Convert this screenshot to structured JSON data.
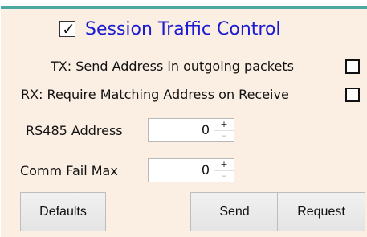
{
  "header": {
    "checked": true,
    "check_glyph": "✓",
    "title": "Session Traffic Control"
  },
  "options": {
    "tx_label": "TX: Send Address in outgoing packets",
    "tx_checked": false,
    "rx_label": "RX: Require Matching Address on Receive",
    "rx_checked": false
  },
  "fields": {
    "rs485_label": "RS485 Address",
    "rs485_value": "0",
    "comm_fail_label": "Comm Fail Max",
    "comm_fail_value": "0",
    "spin_up": "+",
    "spin_down": "–"
  },
  "buttons": {
    "defaults": "Defaults",
    "send": "Send",
    "request": "Request"
  },
  "colors": {
    "accent_border": "#4da8a0",
    "panel_bg": "#fbeee3",
    "title_text": "#1a1ad0"
  }
}
